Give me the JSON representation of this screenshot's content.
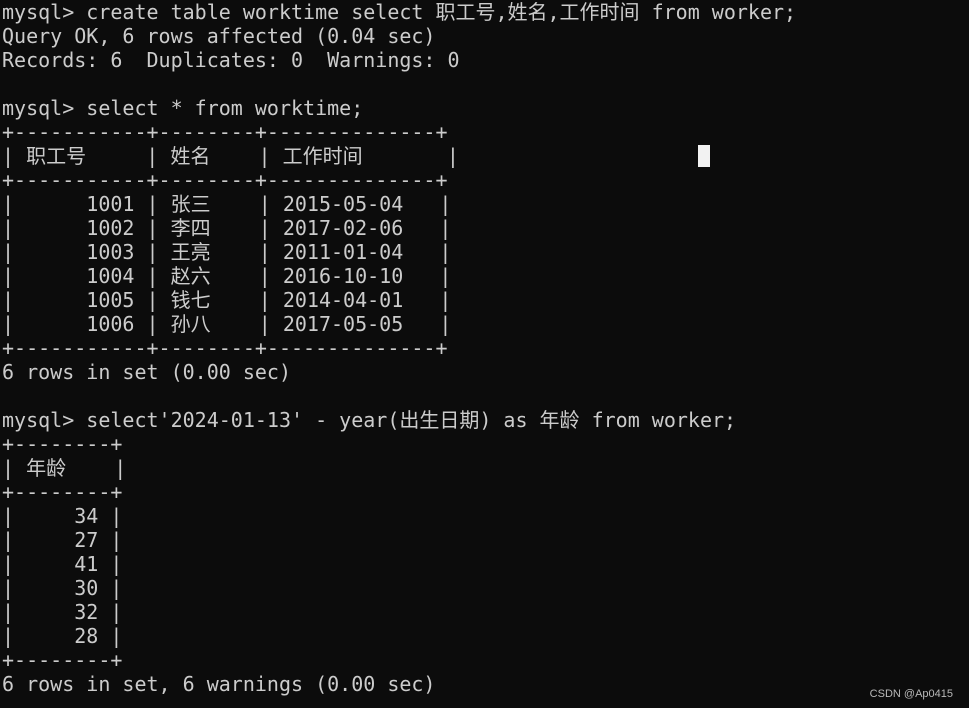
{
  "terminal": {
    "lines": [
      "mysql> create table worktime select 职工号,姓名,工作时间 from worker;",
      "Query OK, 6 rows affected (0.04 sec)",
      "Records: 6  Duplicates: 0  Warnings: 0",
      "",
      "mysql> select * from worktime;",
      "+-----------+--------+--------------+",
      "| 职工号     | 姓名    | 工作时间       |",
      "+-----------+--------+--------------+",
      "|      1001 | 张三    | 2015-05-04   |",
      "|      1002 | 李四    | 2017-02-06   |",
      "|      1003 | 王亮    | 2011-01-04   |",
      "|      1004 | 赵六    | 2016-10-10   |",
      "|      1005 | 钱七    | 2014-04-01   |",
      "|      1006 | 孙八    | 2017-05-05   |",
      "+-----------+--------+--------------+",
      "6 rows in set (0.00 sec)",
      "",
      "mysql> select'2024-01-13' - year(出生日期) as 年龄 from worker;",
      "+--------+",
      "| 年龄    |",
      "+--------+",
      "|     34 |",
      "|     27 |",
      "|     41 |",
      "|     30 |",
      "|     32 |",
      "|     28 |",
      "+--------+",
      "6 rows in set, 6 warnings (0.00 sec)"
    ]
  },
  "watermark": "CSDN @Ap0415",
  "colors": {
    "background": "#0c0c0c",
    "text": "#cccccc",
    "cursor": "#f2f2f2"
  }
}
